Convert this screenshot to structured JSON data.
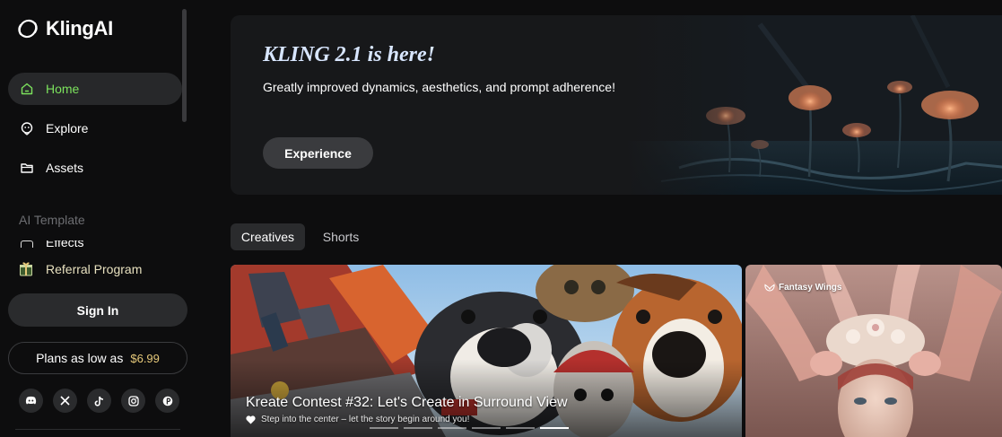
{
  "app": {
    "logo_text": "KlingAI"
  },
  "sidebar": {
    "items": [
      {
        "label": "Home",
        "icon": "home-icon",
        "active": true
      },
      {
        "label": "Explore",
        "icon": "explore-icon",
        "active": false
      },
      {
        "label": "Assets",
        "icon": "folder-icon",
        "active": false
      }
    ],
    "section_label": "AI Template",
    "clipped_item_label": "Effects",
    "referral_label": "Referral Program",
    "signin_label": "Sign In",
    "plans_label": "Plans as low as",
    "plans_price": "$6.99",
    "socials": [
      {
        "name": "discord-icon",
        "glyph": "◉"
      },
      {
        "name": "x-icon",
        "glyph": "𝕏"
      },
      {
        "name": "tiktok-icon",
        "glyph": "♪"
      },
      {
        "name": "instagram-icon",
        "glyph": "◎"
      },
      {
        "name": "pinterest-icon",
        "glyph": "P"
      }
    ]
  },
  "banner": {
    "title": "KLING 2.1 is here!",
    "subtitle": "Greatly improved dynamics, aesthetics, and prompt adherence!",
    "button_label": "Experience"
  },
  "tabs": [
    {
      "label": "Creatives",
      "active": true
    },
    {
      "label": "Shorts",
      "active": false
    }
  ],
  "cards": [
    {
      "title": "Kreate Contest #32: Let's Create in Surround View",
      "subtitle": "Step into the center – let the story begin around you!"
    },
    {
      "tag": "Fantasy Wings"
    }
  ],
  "colors": {
    "accent_green": "#7ce25d",
    "price_gold": "#e6c97a",
    "referral_text": "#e8e1bf",
    "background": "#0d0d0e"
  }
}
